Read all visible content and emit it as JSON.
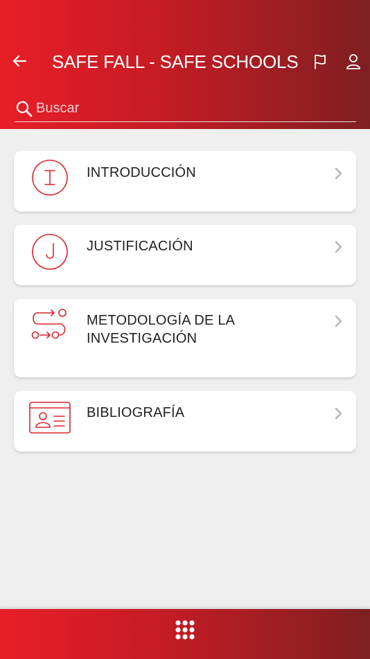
{
  "header": {
    "title": "SAFE FALL - SAFE SCHOOLS",
    "back_icon": "arrow-left-icon",
    "flag_icon": "flag-icon",
    "user_icon": "user-icon"
  },
  "search": {
    "placeholder": "Buscar",
    "value": ""
  },
  "menu": {
    "items": [
      {
        "label": "INTRODUCCIÓN",
        "icon": "letter-i-circle-icon"
      },
      {
        "label": "JUSTIFICACIÓN",
        "icon": "letter-j-circle-icon"
      },
      {
        "label": "METODOLOGÍA DE LA INVESTIGACIÓN",
        "icon": "workflow-icon"
      },
      {
        "label": "BIBLIOGRAFÍA",
        "icon": "id-card-icon"
      }
    ]
  },
  "bottom_bar": {
    "grid_icon": "grid-menu-icon"
  },
  "colors": {
    "accent": "#e81e27",
    "accent_dark": "#7e1f22",
    "icon_red": "#d9252b",
    "background": "#efefef"
  }
}
